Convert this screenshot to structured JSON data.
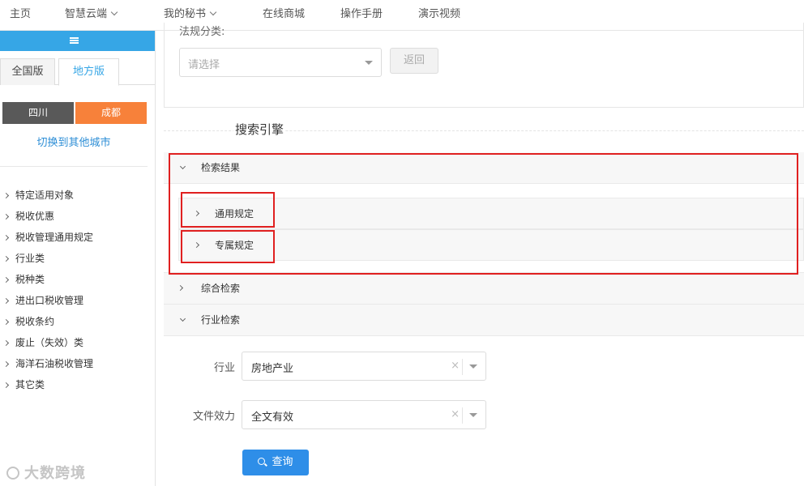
{
  "topnav": {
    "items": [
      {
        "label": "主页"
      },
      {
        "label": "智慧云端"
      },
      {
        "label": "我的秘书"
      },
      {
        "label": "在线商城"
      },
      {
        "label": "操作手册"
      },
      {
        "label": "演示视频"
      }
    ]
  },
  "sidebar": {
    "tabs": [
      {
        "label": "全国版"
      },
      {
        "label": "地方版"
      }
    ],
    "active_tab": "地方版",
    "region": {
      "province": "四川",
      "city": "成都"
    },
    "switch_city_link": "切换到其他城市",
    "categories": [
      {
        "label": "特定适用对象"
      },
      {
        "label": "税收优惠"
      },
      {
        "label": "税收管理通用规定"
      },
      {
        "label": "行业类"
      },
      {
        "label": "税种类"
      },
      {
        "label": "进出口税收管理"
      },
      {
        "label": "税收条约"
      },
      {
        "label": "废止（失效）类"
      },
      {
        "label": "海洋石油税收管理"
      },
      {
        "label": "其它类"
      }
    ]
  },
  "main": {
    "law_category_label": "法规分类:",
    "law_category_select": {
      "placeholder": "请选择"
    },
    "back_button": "返回",
    "section_title": "搜索引擎",
    "panels": {
      "results": {
        "label": "检索结果",
        "sub": [
          {
            "label": "通用规定"
          },
          {
            "label": "专属规定"
          }
        ]
      },
      "comprehensive": {
        "label": "综合检索"
      },
      "industry": {
        "label": "行业检索"
      }
    },
    "form": {
      "industry": {
        "label": "行业",
        "value": "房地产业",
        "clear": "×"
      },
      "validity": {
        "label": "文件效力",
        "value": "全文有效",
        "clear": "×"
      }
    },
    "query_button": "查询"
  },
  "watermark": "大数跨境",
  "colors": {
    "accent_blue": "#36a6e6",
    "city_orange": "#f7813a",
    "province_gray": "#595959",
    "highlight_red": "#e02020",
    "query_blue": "#2e8ee8"
  }
}
